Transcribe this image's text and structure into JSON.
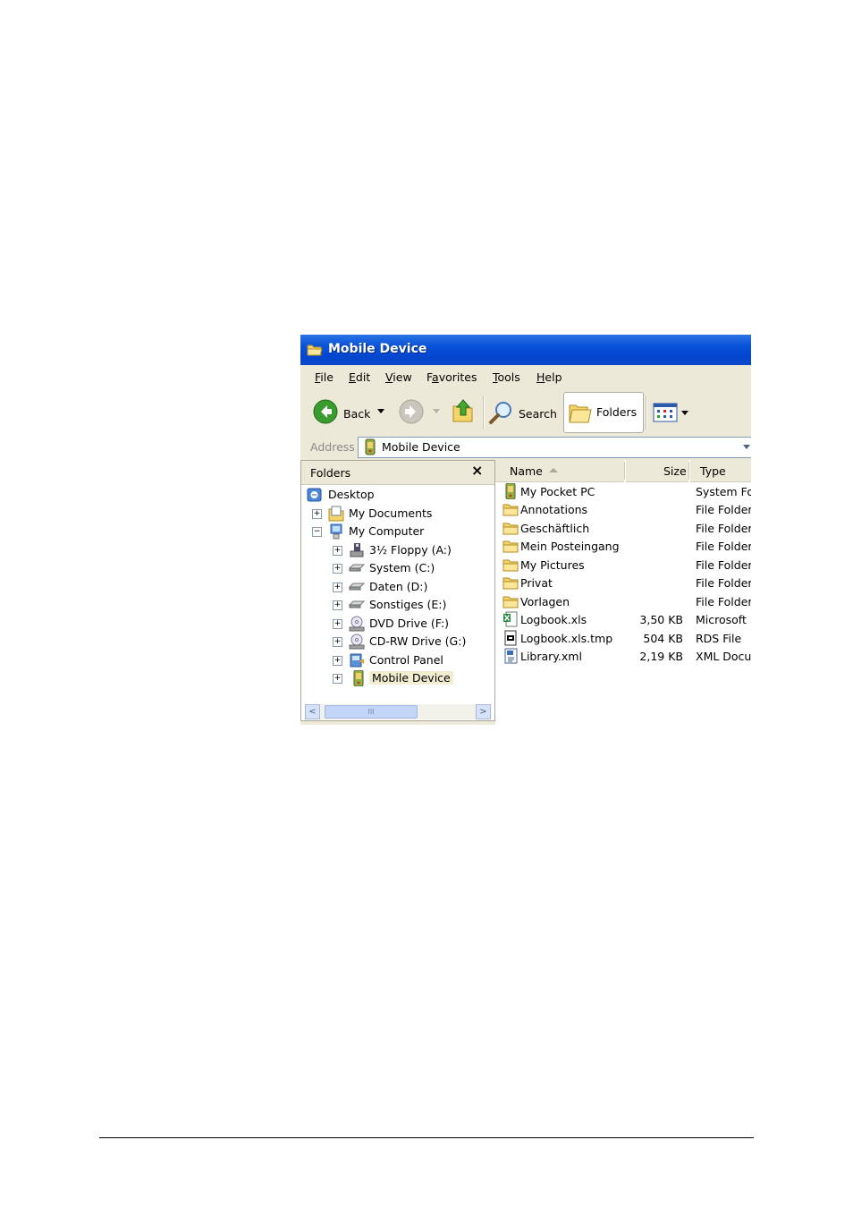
{
  "window": {
    "title": "Mobile Device",
    "accent": "#0a54d9"
  },
  "menu": {
    "items": [
      {
        "label": "File",
        "u": "F",
        "rest": "ile"
      },
      {
        "label": "Edit",
        "u": "E",
        "rest": "dit"
      },
      {
        "label": "View",
        "u": "V",
        "rest": "iew"
      },
      {
        "label": "Favorites",
        "pre": "F",
        "u": "a",
        "rest": "vorites"
      },
      {
        "label": "Tools",
        "u": "T",
        "rest": "ools"
      },
      {
        "label": "Help",
        "u": "H",
        "rest": "elp"
      }
    ]
  },
  "toolbar": {
    "back_label": "Back",
    "search_label": "Search",
    "folders_label": "Folders"
  },
  "address": {
    "label": "Address",
    "value": "Mobile Device"
  },
  "folders_pane": {
    "title": "Folders",
    "close": "×",
    "tree": [
      {
        "label": "Desktop",
        "icon": "desktop-icon",
        "level": 0,
        "expander": ""
      },
      {
        "label": "My Documents",
        "icon": "my-documents-icon",
        "level": 1,
        "expander": "+"
      },
      {
        "label": "My Computer",
        "icon": "my-computer-icon",
        "level": 1,
        "expander": "−"
      },
      {
        "label": "3½ Floppy (A:)",
        "icon": "floppy-icon",
        "level": 2,
        "expander": "+"
      },
      {
        "label": "System (C:)",
        "icon": "hard-drive-icon",
        "level": 2,
        "expander": "+"
      },
      {
        "label": "Daten (D:)",
        "icon": "hard-drive-icon",
        "level": 2,
        "expander": "+"
      },
      {
        "label": "Sonstiges (E:)",
        "icon": "hard-drive-icon",
        "level": 2,
        "expander": "+"
      },
      {
        "label": "DVD Drive (F:)",
        "icon": "dvd-drive-icon",
        "level": 2,
        "expander": "+"
      },
      {
        "label": "CD-RW Drive (G:)",
        "icon": "cd-drive-icon",
        "level": 2,
        "expander": "+"
      },
      {
        "label": "Control Panel",
        "icon": "control-panel-icon",
        "level": 2,
        "expander": "+"
      },
      {
        "label": "Mobile Device",
        "icon": "mobile-device-icon",
        "level": 2,
        "expander": "+",
        "selected": true
      }
    ]
  },
  "files": {
    "columns": {
      "name": "Name",
      "size": "Size",
      "type": "Type"
    },
    "rows": [
      {
        "name": "My Pocket PC",
        "size": "",
        "type": "System Fo",
        "icon": "pocket-pc-icon"
      },
      {
        "name": "Annotations",
        "size": "",
        "type": "File Folder",
        "icon": "folder-icon"
      },
      {
        "name": "Geschäftlich",
        "size": "",
        "type": "File Folder",
        "icon": "folder-icon"
      },
      {
        "name": "Mein Posteingang",
        "size": "",
        "type": "File Folder",
        "icon": "folder-icon"
      },
      {
        "name": "My Pictures",
        "size": "",
        "type": "File Folder",
        "icon": "folder-icon"
      },
      {
        "name": "Privat",
        "size": "",
        "type": "File Folder",
        "icon": "folder-icon"
      },
      {
        "name": "Vorlagen",
        "size": "",
        "type": "File Folder",
        "icon": "folder-icon"
      },
      {
        "name": "Logbook.xls",
        "size": "3,50 KB",
        "type": "Microsoft E",
        "icon": "excel-file-icon"
      },
      {
        "name": "Logbook.xls.tmp",
        "size": "504 KB",
        "type": "RDS File",
        "icon": "tmp-file-icon"
      },
      {
        "name": "Library.xml",
        "size": "2,19 KB",
        "type": "XML Docur",
        "icon": "xml-file-icon"
      }
    ]
  },
  "scrollbar": {
    "left_arrow": "<",
    "right_arrow": ">",
    "thumb_grip": "III"
  }
}
